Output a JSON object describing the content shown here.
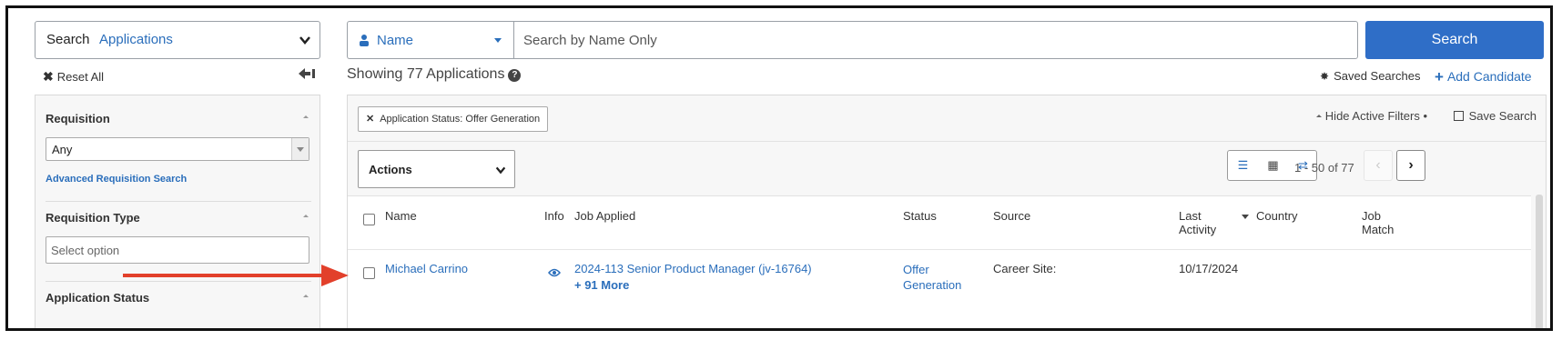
{
  "search_scope": {
    "label": "Search",
    "value": "Applications"
  },
  "name_filter": {
    "label": "Name"
  },
  "search_input": {
    "placeholder": "Search by Name Only"
  },
  "search_button": "Search",
  "reset_all": "Reset All",
  "showing_text": "Showing 77 Applications",
  "saved_searches": "Saved Searches",
  "add_candidate": "Add Candidate",
  "filters": {
    "requisition": {
      "title": "Requisition",
      "selected": "Any",
      "advanced_link": "Advanced Requisition Search"
    },
    "requisition_type": {
      "title": "Requisition Type",
      "placeholder": "Select option"
    },
    "application_status": {
      "title": "Application Status"
    }
  },
  "active_filter_chip": "Application Status: Offer Generation",
  "hide_active_filters": "Hide Active Filters •",
  "save_search": "Save Search",
  "actions_label": "Actions",
  "pager_text": "1 - 50 of 77",
  "table": {
    "headers": {
      "name": "Name",
      "info": "Info",
      "job_applied": "Job Applied",
      "status": "Status",
      "source": "Source",
      "last_activity_1": "Last",
      "last_activity_2": "Activity",
      "country": "Country",
      "job_match_1": "Job",
      "job_match_2": "Match"
    },
    "rows": [
      {
        "name": "Michael Carrino",
        "job": "2024-113 Senior Product Manager (jv-16764)",
        "more": "+ 91 More",
        "status_1": "Offer",
        "status_2": "Generation",
        "source": "Career Site:",
        "last_activity": "10/17/2024"
      }
    ]
  },
  "colors": {
    "accent": "#2a6ebb",
    "button": "#2f6ec7",
    "arrow": "#e2402b"
  }
}
